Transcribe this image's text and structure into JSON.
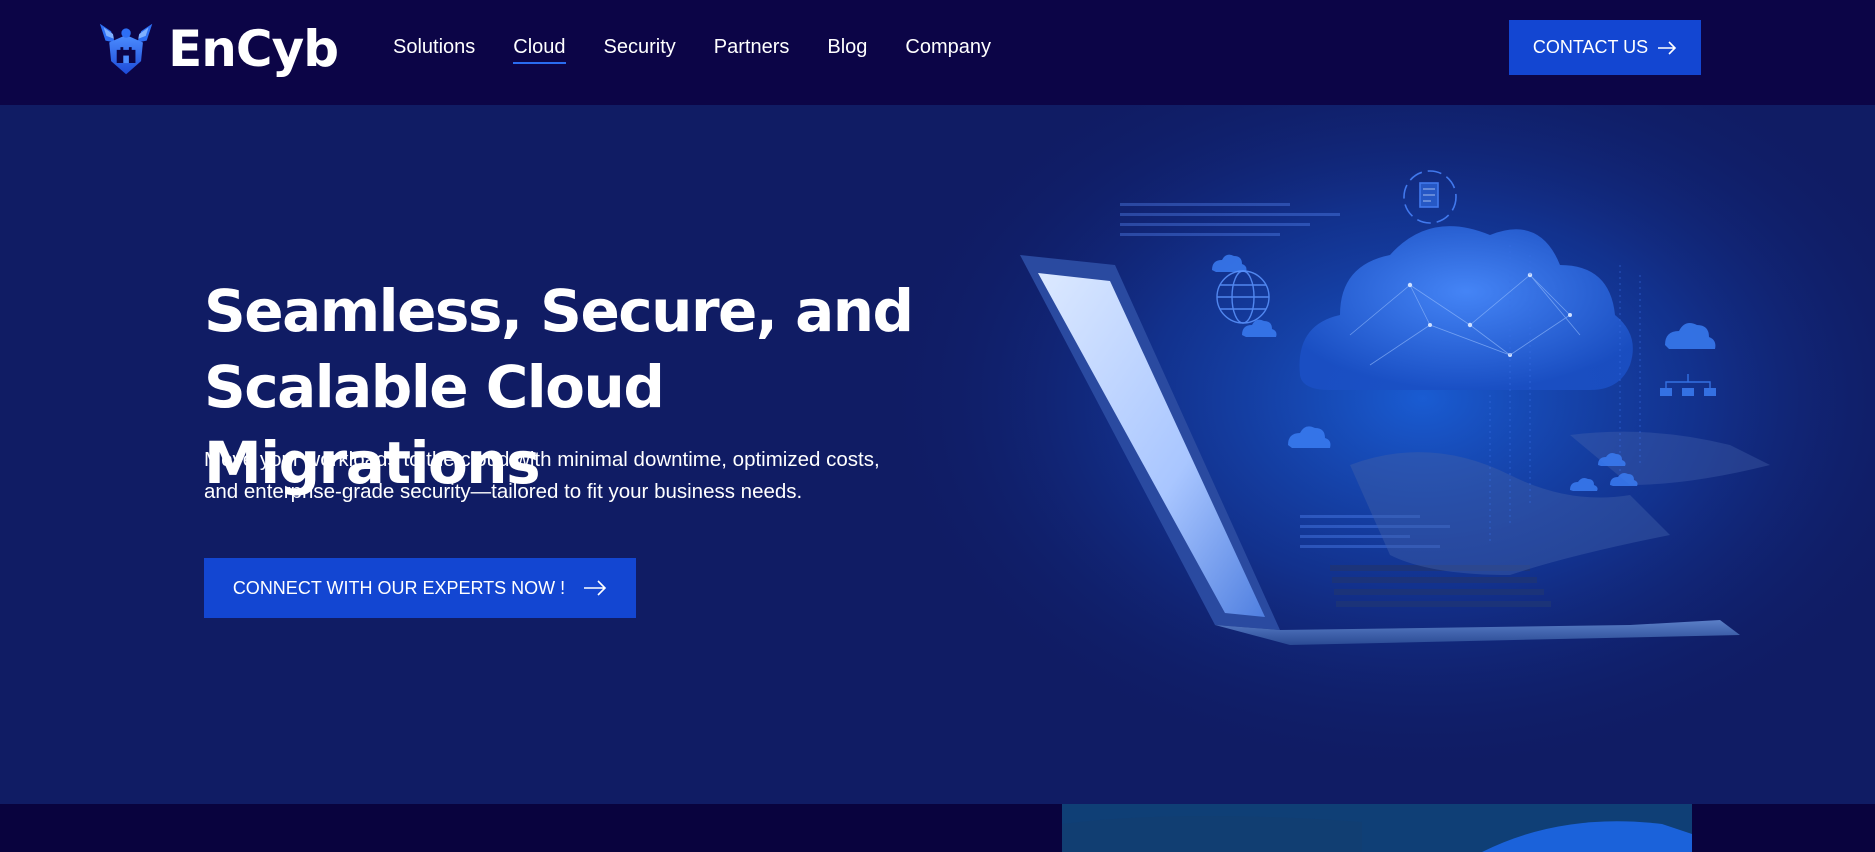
{
  "brand": {
    "name": "EnCyb",
    "accent_color": "#1346d2",
    "header_bg": "#0c0547",
    "hero_bg": "#101c64"
  },
  "header": {
    "logo_icon": "shield-eagle-icon",
    "nav": [
      {
        "label": "Solutions",
        "active": false
      },
      {
        "label": "Cloud",
        "active": true
      },
      {
        "label": "Security",
        "active": false
      },
      {
        "label": "Partners",
        "active": false
      },
      {
        "label": "Blog",
        "active": false
      },
      {
        "label": "Company",
        "active": false
      }
    ],
    "contact_label": "CONTACT US",
    "contact_icon": "arrow-right-icon"
  },
  "hero": {
    "title_line1": "Seamless, Secure, and",
    "title_line2": "Scalable Cloud Migrations",
    "subtitle_line1": "Move your workloads to the cloud with minimal downtime, optimized costs,",
    "subtitle_line2": "and enterprise-grade security—tailored to fit your business needs.",
    "cta_label": "CONNECT WITH OUR EXPERTS NOW !",
    "cta_icon": "arrow-right-icon",
    "image_icons": [
      "laptop-icon",
      "cloud-network-icon",
      "globe-icon",
      "document-icon",
      "network-hierarchy-icon"
    ]
  }
}
